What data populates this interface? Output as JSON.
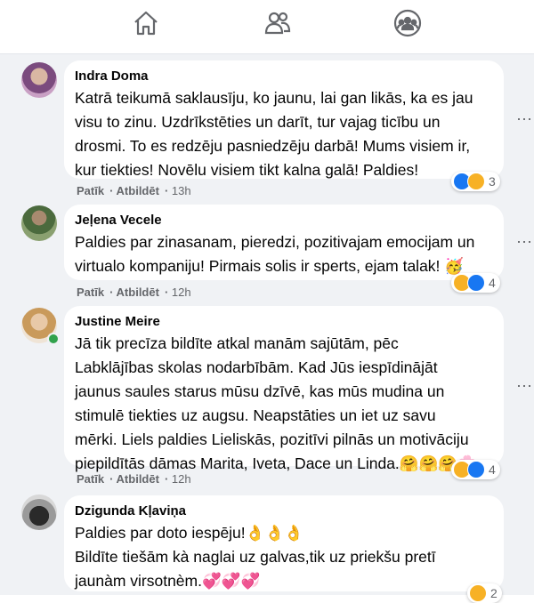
{
  "nav": {
    "home_icon": "home-icon",
    "friends_icon": "friends-icon",
    "groups_icon": "groups-icon"
  },
  "comments": [
    {
      "name": "Indra Doma",
      "text": "Katrā teikumā saklausīju, ko jaunu, lai gan likās, ka es jau\nvisu to zinu. Uzdrīkstēties un darīt, tur vajag ticību un\ndrosmi. To es redzēju pasniedzēju darbā! Mums visiem ir,\nkur tiekties! Novēlu visiem tikt kalna galā! Paldies!",
      "like": "Patīk",
      "reply": "Atbildēt",
      "time": "13h",
      "reaction_count": "3",
      "reactions": [
        "like",
        "care"
      ]
    },
    {
      "name": "Jeļena Vecele",
      "text": "Paldies par zinasanam, pieredzi, pozitivajam emocijam un\nvirtualo kompaniju! Pirmais solis ir sperts, ejam talak! 🥳",
      "like": "Patīk",
      "reply": "Atbildēt",
      "time": "12h",
      "reaction_count": "4",
      "reactions": [
        "care",
        "like"
      ]
    },
    {
      "name": "Justine Meire",
      "text": "Jā tik precīza bildīte atkal manām sajūtām, pēc\nLabklājības skolas nodarbībām. Kad Jūs iespīdinājāt\njaunus saules starus mūsu dzīvē, kas mūs mudina un\nstimulē tiekties uz augsu. Neapstāties un iet uz savu\nmērki. Liels paldies Lieliskās, pozitīvi pilnās un motivāciju\npiepildītās dāmas Marita, Iveta, Dace un Linda.🤗🤗🤗🌸",
      "like": "Patīk",
      "reply": "Atbildēt",
      "time": "12h",
      "reaction_count": "4",
      "reactions": [
        "care",
        "like"
      ]
    },
    {
      "name": "Dzigunda Kļaviņa",
      "text": "Paldies par doto iespēju!👌👌👌\nBildīte tiešām kà naglai uz galvas,tik uz priekšu pretī\njaunàm virsotnèm.💞💞💞",
      "reaction_count": "2",
      "reactions": [
        "care"
      ]
    }
  ],
  "colors": {
    "like_blue": "#1877f2",
    "care_yellow": "#f7b125",
    "online_green": "#31a24c",
    "muted": "#65676b"
  }
}
